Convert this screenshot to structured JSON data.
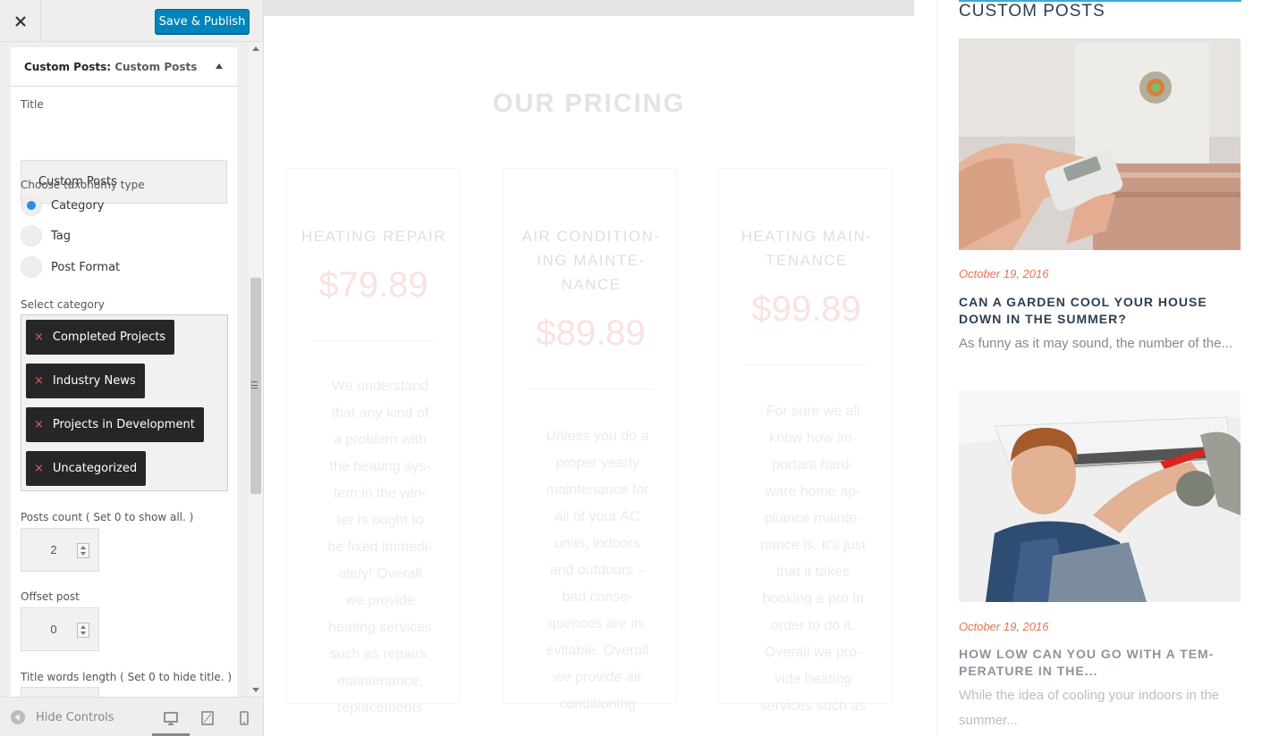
{
  "header": {
    "publish_label": "Save & Publish"
  },
  "section": {
    "title_prefix": "Custom Posts:",
    "title_name": "Custom Posts"
  },
  "form": {
    "title_label": "Title",
    "title_value": "Custom Posts",
    "taxonomy_label": "Choose taxonomy type",
    "taxonomy_options": [
      "Category",
      "Tag",
      "Post Format"
    ],
    "taxonomy_selected": "Category",
    "category_label": "Select category",
    "selected_categories": [
      "Completed Projects",
      "Industry News",
      "Projects in Development",
      "Uncategorized"
    ],
    "remove_symbol": "×",
    "posts_count_label": "Posts count ( Set 0 to show all. )",
    "posts_count_value": "2",
    "offset_label": "Offset post",
    "offset_value": "0",
    "title_words_label": "Title words length ( Set 0 to hide title. )"
  },
  "footer": {
    "hide_controls_label": "Hide Controls",
    "devices": [
      "desktop-icon",
      "tablet-icon",
      "mobile-icon"
    ],
    "active_device": "desktop-icon"
  },
  "pricing": {
    "heading": "OUR PRICING",
    "plans": [
      {
        "name_lines": [
          "HEATING REPAIR"
        ],
        "price": "$79.89",
        "desc_lines": [
          "We understand",
          "that any kind of",
          "a problem with",
          "the heating sys-",
          "tem in the win-",
          "ter is ought to",
          "be fixed immedi-",
          "ately! Overall",
          "we provide",
          "heating services",
          "such as repairs,",
          "maintenance,",
          "replacements"
        ]
      },
      {
        "name_lines": [
          "AIR CONDITION-",
          "ING MAINTE-",
          "NANCE"
        ],
        "price": "$89.89",
        "desc_lines": [
          "Unless you do a",
          "proper yearly",
          "maintenance for",
          "all of your AC",
          "units, indoors",
          "and outdoors –",
          "bad conse-",
          "quences are in-",
          "evitable. Overall",
          "we provide air",
          "conditioning"
        ]
      },
      {
        "name_lines": [
          "HEATING MAIN-",
          "TENANCE"
        ],
        "price": "$99.89",
        "desc_lines": [
          "For sure we all",
          "know how im-",
          "portant hard-",
          "ware home ap-",
          "pliance mainte-",
          "nance is. It's just",
          "that it takes",
          "booking a pro in",
          "order to do it.",
          "Overall we pro-",
          "vide heating",
          "services such as"
        ]
      }
    ]
  },
  "sidebar": {
    "title": "CUSTOM POSTS",
    "posts": [
      {
        "date": "October 19, 2016",
        "title_lines": [
          "CAN A GARDEN COOL YOUR HOUSE",
          "DOWN IN THE SUMMER?"
        ],
        "excerpt_lines": [
          "As funny as it may sound, the number of the..."
        ]
      },
      {
        "date": "October 19, 2016",
        "title_lines": [
          "HOW LOW CAN YOU GO WITH A TEM-",
          "PERATURE IN THE..."
        ],
        "excerpt_lines": [
          "While the idea of cooling your indoors in the",
          "summer..."
        ]
      }
    ]
  },
  "colors": {
    "accent": "#0085ba",
    "radio_checked": "#2b8cf2",
    "tag_bg": "#262626",
    "tag_remove": "#e05f5f",
    "post_date": "#e9734f",
    "post_title": "#2c3e50",
    "sidebar_topline": "#38a9d8"
  }
}
